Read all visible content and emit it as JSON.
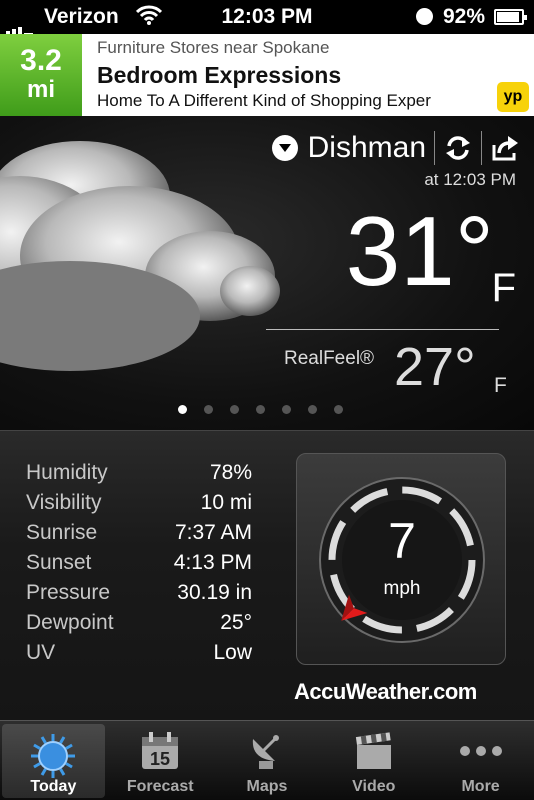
{
  "status_bar": {
    "carrier": "Verizon",
    "time": "12:03 PM",
    "battery": "92%",
    "battery_level": 0.92
  },
  "ad": {
    "distance": "3.2",
    "distance_unit": "mi",
    "category": "Furniture Stores near Spokane",
    "business_name": "Bedroom Expressions",
    "tagline": "Home To A Different Kind of Shopping Exper",
    "badge": "YP"
  },
  "current": {
    "location": "Dishman",
    "updated": "at 12:03 PM",
    "temperature": "31°",
    "temp_unit": "F",
    "realfeel_label": "RealFeel®",
    "realfeel": "27°",
    "realfeel_unit": "F",
    "page_count": 7,
    "active_page": 0
  },
  "details": [
    {
      "label": "Humidity",
      "value": "78%"
    },
    {
      "label": "Visibility",
      "value": "10 mi"
    },
    {
      "label": "Sunrise",
      "value": "7:37 AM"
    },
    {
      "label": "Sunset",
      "value": "4:13 PM"
    },
    {
      "label": "Pressure",
      "value": "30.19 in"
    },
    {
      "label": "Dewpoint",
      "value": "25°"
    },
    {
      "label": "UV",
      "value": "Low"
    }
  ],
  "wind": {
    "speed": "7",
    "unit": "mph",
    "direction_deg": 225
  },
  "brand": "AccuWeather.com",
  "tabs": [
    {
      "label": "Today",
      "icon": "sun-icon",
      "active": true
    },
    {
      "label": "Forecast",
      "icon": "calendar-icon",
      "day": "15"
    },
    {
      "label": "Maps",
      "icon": "satellite-dish-icon"
    },
    {
      "label": "Video",
      "icon": "clapperboard-icon"
    },
    {
      "label": "More",
      "icon": "more-dots-icon"
    }
  ],
  "colors": {
    "ad_distance_green": "#4fae24",
    "yp_yellow": "#f7d20a",
    "wind_arrow_red": "#e21b1b"
  }
}
